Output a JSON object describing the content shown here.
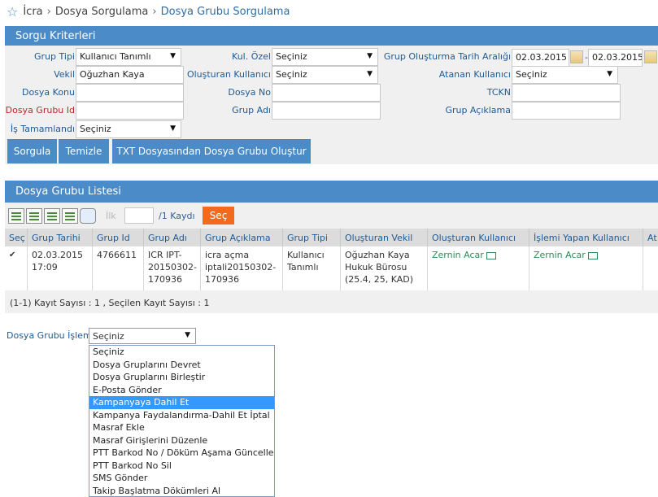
{
  "breadcrumb": {
    "home": "İcra",
    "section": "Dosya Sorgulama",
    "current": "Dosya Grubu Sorgulama"
  },
  "criteria": {
    "title": "Sorgu Kriterleri",
    "grup_tipi_label": "Grup Tipi",
    "grup_tipi_value": "Kullanıcı Tanımlı",
    "kul_ozel_label": "Kul. Özel",
    "kul_ozel_value": "Seçiniz",
    "tarih_label": "Grup Oluşturma Tarih Aralığı",
    "tarih_from": "02.03.2015",
    "tarih_sep": "-",
    "tarih_to": "02.03.2015",
    "vekil_label": "Vekil",
    "vekil_value": "Oğuzhan Kaya",
    "olusturan_label": "Oluşturan Kullanıcı",
    "olusturan_value": "Seçiniz",
    "atanan_label": "Atanan Kullanıcı",
    "atanan_value": "Seçiniz",
    "konu_label": "Dosya Konu",
    "konu_value": "",
    "dosya_no_label": "Dosya No",
    "dosya_no_value": "",
    "tckn_label": "TCKN",
    "tckn_value": "",
    "grup_id_label": "Dosya Grubu Id",
    "grup_id_value": "",
    "grup_adi_label": "Grup Adı",
    "grup_adi_value": "",
    "grup_aciklama_label": "Grup Açıklama",
    "grup_aciklama_value": "",
    "tamamlandi_label": "İş Tamamlandı",
    "tamamlandi_value": "Seçiniz",
    "sorgula": "Sorgula",
    "temizle": "Temizle",
    "txt_button": "TXT Dosyasından Dosya Grubu Oluştur"
  },
  "list": {
    "title": "Dosya Grubu Listesi",
    "pager_first": "İlk",
    "pager_page": "",
    "pager_total": "/1 Kaydı",
    "pager_button": "Seç",
    "headers": [
      "Seç",
      "Grup Tarihi",
      "Grup Id",
      "Grup Adı",
      "Grup Açıklama",
      "Grup Tipi",
      "Oluşturan Vekil",
      "Oluşturan Kullanıcı",
      "İşlemi Yapan Kullanıcı",
      "At"
    ],
    "row": {
      "checked": "✔",
      "tarih": "02.03.2015 17:09",
      "id": "4766611",
      "adi": "ICR IPT-20150302-170936",
      "aciklama": "icra açma iptali20150302-170936",
      "tipi": "Kullanıcı Tanımlı",
      "vekil": "Oğuzhan Kaya Hukuk Bürosu (25.4, 25, KAD)",
      "olusturan": "Zernin Acar",
      "islem": "Zernin Acar"
    },
    "footer": "(1-1) Kayıt Sayısı : 1 , Seçilen Kayıt Sayısı : 1"
  },
  "action": {
    "label": "Dosya Grubu İşlem",
    "selected": "Seçiniz",
    "options": [
      "Seçiniz",
      "Dosya Gruplarını Devret",
      "Dosya Gruplarını Birleştir",
      "E-Posta Gönder",
      "Kampanyaya Dahil Et",
      "Kampanya Faydalandırma-Dahil Et İptal",
      "Masraf Ekle",
      "Masraf Girişlerini Düzenle",
      "PTT Barkod No / Döküm Aşama Güncelle",
      "PTT Barkod No Sil",
      "SMS Gönder",
      "Takip Başlatma Dökümleri Al"
    ],
    "highlighted": "Kampanyaya Dahil Et"
  },
  "colors": {
    "header_blue": "#4b8bc8",
    "orange": "#f26b1d",
    "link_green": "#2e8b57",
    "highlight": "#3399ff"
  }
}
